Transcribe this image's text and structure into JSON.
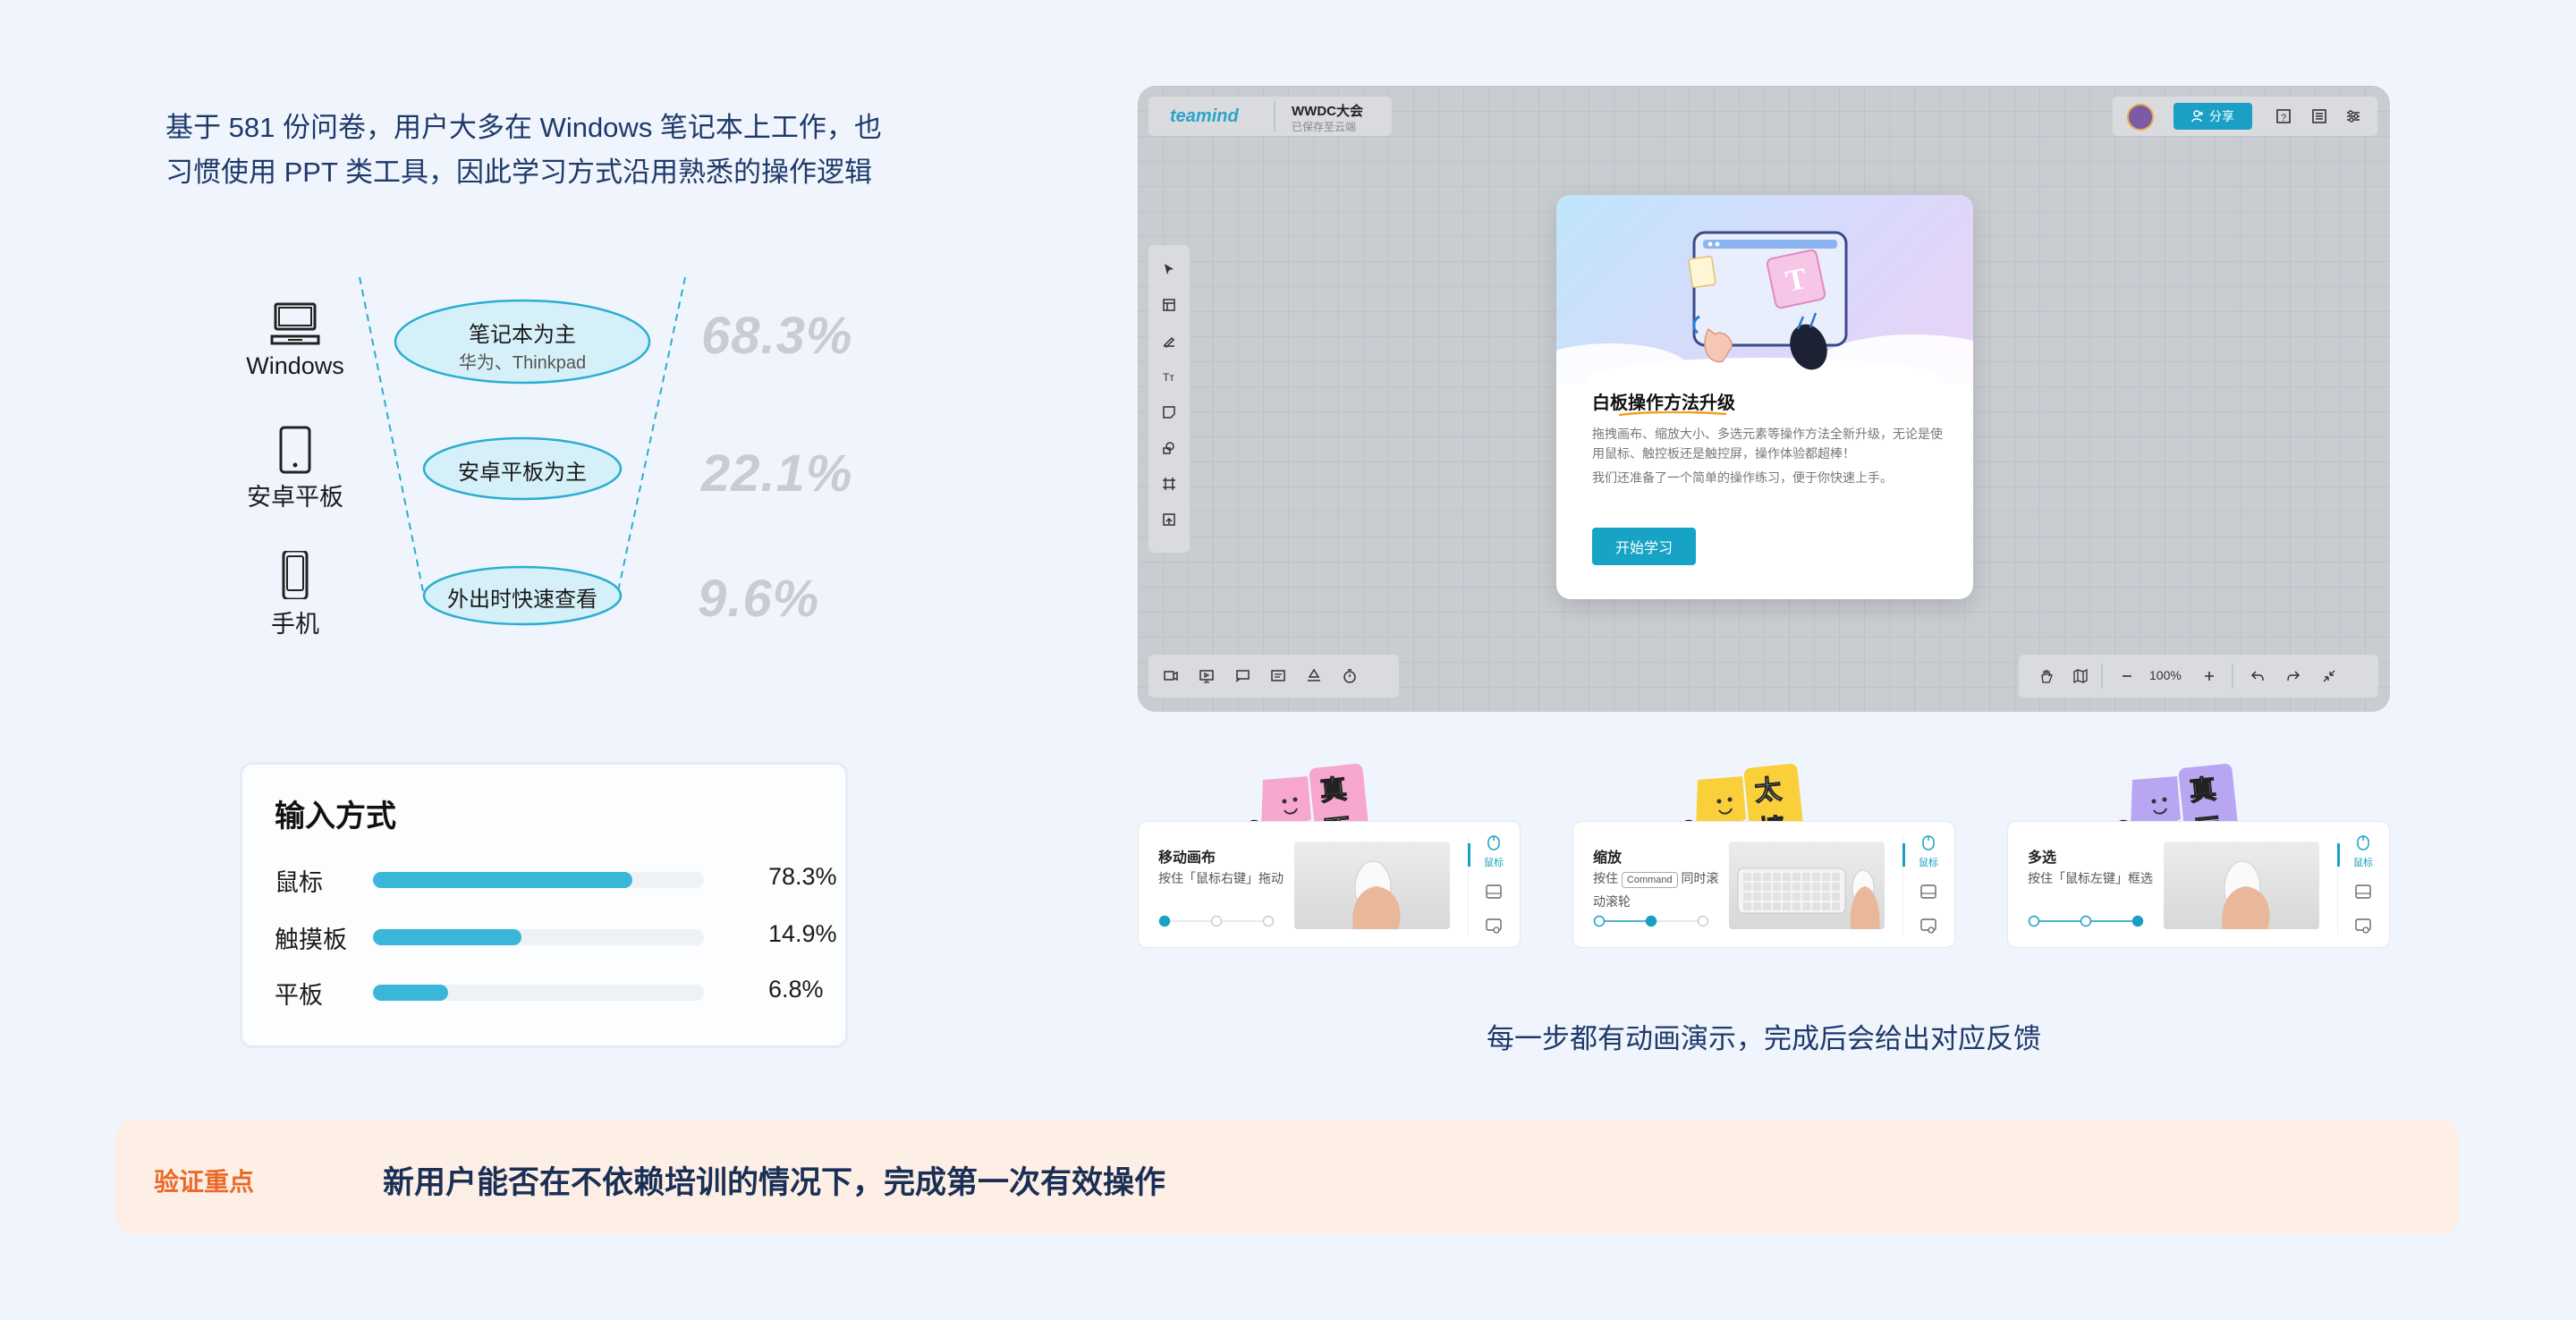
{
  "intro": {
    "line1": "基于 581 份问卷，用户大多在 Windows 笔记本上工作，也",
    "line2": "习惯使用 PPT 类工具，因此学习方式沿用熟悉的操作逻辑"
  },
  "devices": [
    {
      "label": "Windows",
      "icon": "laptop-icon",
      "usage": "笔记本为主",
      "sub": "华为、Thinkpad",
      "percent": "68.3%"
    },
    {
      "label": "安卓平板",
      "icon": "tablet-icon",
      "usage": "安卓平板为主",
      "sub": "",
      "percent": "22.1%"
    },
    {
      "label": "手机",
      "icon": "phone-icon",
      "usage": "外出时快速查看",
      "sub": "",
      "percent": "9.6%"
    }
  ],
  "input_methods": {
    "title": "输入方式",
    "items": [
      {
        "label": "鼠标",
        "value": "78.3%",
        "fraction": 0.783
      },
      {
        "label": "触摸板",
        "value": "14.9%",
        "fraction": 0.449
      },
      {
        "label": "平板",
        "value": "6.8%",
        "fraction": 0.226
      }
    ]
  },
  "whiteboard": {
    "logo": "teamind",
    "doc_title": "WWDC大会",
    "doc_status": "已保存至云端",
    "share_label": "分享",
    "zoom": "100%",
    "modal": {
      "title": "白板操作方法升级",
      "desc": "拖拽画布、缩放大小、多选元素等操作方法全新升级，无论是使用鼠标、触控板还是触控屏，操作体验都超棒！",
      "desc2": "我们还准备了一个简单的操作练习，便于你快速上手。",
      "button": "开始学习",
      "hero_letter": "T"
    }
  },
  "tutorials": [
    {
      "title": "移动画布",
      "desc_pre": "按住「鼠标右键」拖动",
      "kbd": "",
      "desc_post": "",
      "sticker": "真不错!",
      "sticker_color": "#f7a6cf",
      "side_label": "鼠标",
      "step": 1
    },
    {
      "title": "缩放",
      "desc_pre": "按住",
      "kbd": "Command",
      "desc_post": "同时滚动滚轮",
      "sticker": "太棒啦!",
      "sticker_color": "#f9cf3a",
      "side_label": "鼠标",
      "step": 2
    },
    {
      "title": "多选",
      "desc_pre": "按住「鼠标左键」框选",
      "kbd": "",
      "desc_post": "",
      "sticker": "真厉害!",
      "sticker_color": "#b9a6f2",
      "side_label": "鼠标",
      "step": 3
    }
  ],
  "caption": "每一步都有动画演示，完成后会给出对应反馈",
  "banner": {
    "tag": "验证重点",
    "text": "新用户能否在不依赖培训的情况下，完成第一次有效操作"
  }
}
